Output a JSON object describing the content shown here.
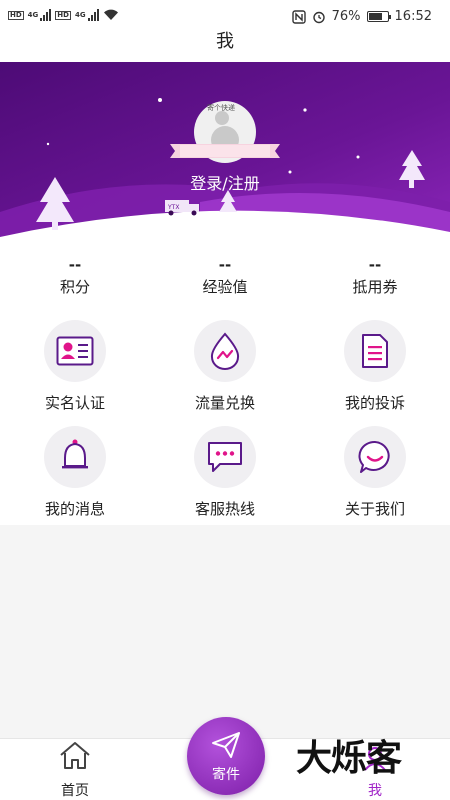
{
  "status_bar": {
    "hd1": "HD",
    "hd2": "HD",
    "net1": "4G",
    "net2": "4G",
    "battery_percent": "76%",
    "battery_level": 0.76,
    "time": "16:52"
  },
  "header": {
    "title": "我"
  },
  "banner": {
    "login_label": "登录/注册",
    "colors": {
      "dark": "#4d0b76",
      "mid": "#7a1aa6",
      "light": "#a23ad0"
    }
  },
  "stats": [
    {
      "value": "--",
      "label": "积分"
    },
    {
      "value": "--",
      "label": "经验值"
    },
    {
      "value": "--",
      "label": "抵用券"
    }
  ],
  "menu": {
    "real_name": "实名认证",
    "traffic": "流量兑换",
    "complaint": "我的投诉",
    "messages": "我的消息",
    "hotline": "客服热线",
    "about": "关于我们"
  },
  "bottom_nav": {
    "home": "首页",
    "send": "寄件",
    "mine": "我",
    "accent": "#a124c8"
  },
  "watermark": "大烁客"
}
